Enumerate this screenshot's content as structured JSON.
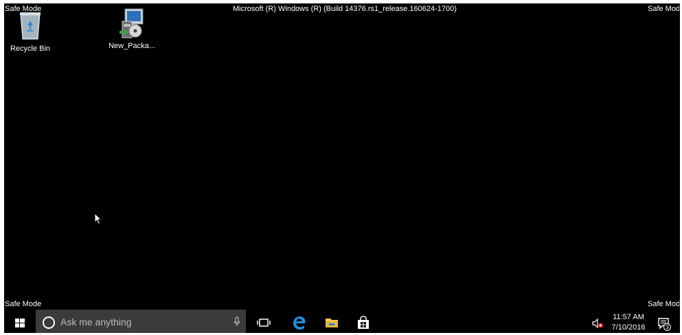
{
  "watermark": {
    "top_left": "Safe Mode",
    "top_right": "Safe Mode",
    "bottom_left": "Safe Mode",
    "bottom_right": "Safe Mode",
    "build": "Microsoft (R) Windows (R) (Build 14376.rs1_release.160624-1700)"
  },
  "desktop": {
    "icons": [
      {
        "label": "Recycle Bin",
        "icon": "recycle-bin-icon"
      },
      {
        "label": "New_Packa...",
        "icon": "installer-package-icon"
      }
    ],
    "background_color": "#000000"
  },
  "taskbar": {
    "search_placeholder": "Ask me anything",
    "pinned": [
      "task-view-icon",
      "edge-icon",
      "file-explorer-icon",
      "store-icon"
    ],
    "clock": {
      "time": "11:57 AM",
      "date": "7/10/2016"
    },
    "notification_count": "3"
  },
  "colors": {
    "search_bg": "#3b3b3b",
    "edge_blue": "#1e8fe0",
    "folder_yellow": "#f2c94c"
  }
}
